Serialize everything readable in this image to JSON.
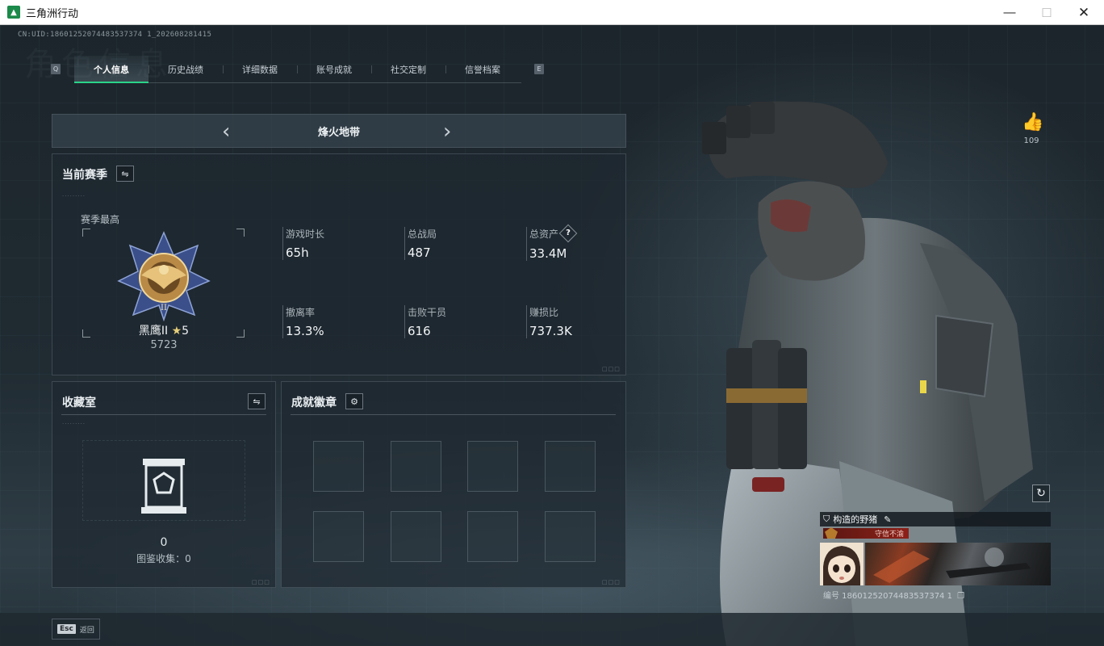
{
  "window": {
    "title": "三角洲行动",
    "minimize": "—",
    "maximize": "☐",
    "close": "✕"
  },
  "uid_line": "CN:UID:18601252074483537374 1_202608281415",
  "watermark": "角色信息",
  "tabs": {
    "left_key": "Q",
    "right_key": "E",
    "items": [
      "个人信息",
      "历史战绩",
      "详细数据",
      "账号成就",
      "社交定制",
      "信誉档案"
    ],
    "active": "个人信息"
  },
  "mode": {
    "title": "烽火地带",
    "prev": "‹",
    "next": "›"
  },
  "season": {
    "title": "当前赛季",
    "best_label": "赛季最高",
    "rank_name": "黑鹰II",
    "rank_stars": "5",
    "rank_points": "5723",
    "stats": [
      {
        "label": "游戏时长",
        "value": "65h"
      },
      {
        "label": "总战局",
        "value": "487"
      },
      {
        "label": "总资产",
        "value": "33.4M",
        "help": "?"
      },
      {
        "label": "撤离率",
        "value": "13.3%"
      },
      {
        "label": "击败干员",
        "value": "616"
      },
      {
        "label": "赚损比",
        "value": "737.3K"
      }
    ]
  },
  "collection": {
    "title": "收藏室",
    "count": "0",
    "subtitle": "图鉴收集：0"
  },
  "achievements": {
    "title": "成就徽章"
  },
  "profile_card": {
    "likes": "109",
    "name": "构造的野猪",
    "tag": "守信不渝",
    "id_line": "编号 18601252074483537374 1"
  },
  "footer": {
    "esc_key": "Esc",
    "esc_label": "返回"
  }
}
